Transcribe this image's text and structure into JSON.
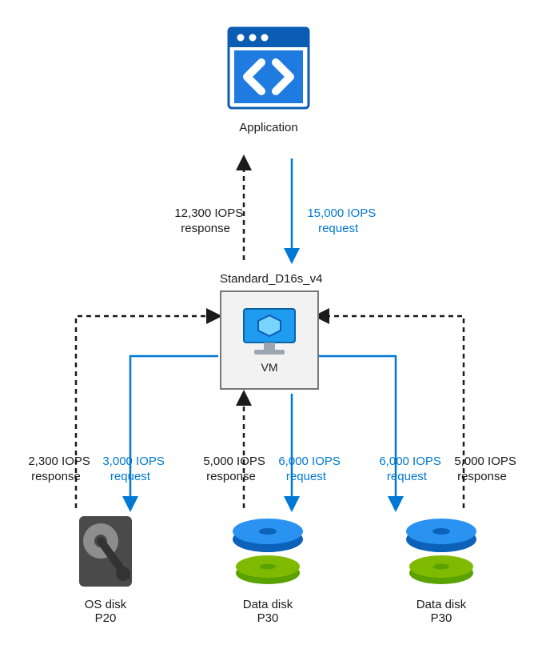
{
  "nodes": {
    "application": {
      "label": "Application"
    },
    "vm": {
      "title": "Standard_D16s_v4",
      "label": "VM"
    },
    "os_disk": {
      "label1": "OS disk",
      "label2": "P20"
    },
    "data_disk_1": {
      "label1": "Data disk",
      "label2": "P30"
    },
    "data_disk_2": {
      "label1": "Data disk",
      "label2": "P30"
    }
  },
  "flows": {
    "app_vm": {
      "request": {
        "line1": "15,000 IOPS",
        "line2": "request"
      },
      "response": {
        "line1": "12,300 IOPS",
        "line2": "response"
      }
    },
    "vm_os": {
      "request": {
        "line1": "3,000 IOPS",
        "line2": "request"
      },
      "response": {
        "line1": "2,300 IOPS",
        "line2": "response"
      }
    },
    "vm_d1": {
      "request": {
        "line1": "6,000 IOPS",
        "line2": "request"
      },
      "response": {
        "line1": "5,000 IOPS",
        "line2": "response"
      }
    },
    "vm_d2": {
      "request": {
        "line1": "6,000 IOPS",
        "line2": "request"
      },
      "response": {
        "line1": "5,000 IOPS",
        "line2": "response"
      }
    }
  },
  "chart_data": {
    "type": "flow-diagram",
    "nodes": [
      {
        "id": "app",
        "label": "Application"
      },
      {
        "id": "vm",
        "label": "Standard_D16s_v4 VM"
      },
      {
        "id": "os",
        "label": "OS disk P20"
      },
      {
        "id": "d1",
        "label": "Data disk P30"
      },
      {
        "id": "d2",
        "label": "Data disk P30"
      }
    ],
    "edges": [
      {
        "from": "app",
        "to": "vm",
        "request_iops": 15000,
        "response_iops": 12300
      },
      {
        "from": "vm",
        "to": "os",
        "request_iops": 3000,
        "response_iops": 2300
      },
      {
        "from": "vm",
        "to": "d1",
        "request_iops": 6000,
        "response_iops": 5000
      },
      {
        "from": "vm",
        "to": "d2",
        "request_iops": 6000,
        "response_iops": 5000
      }
    ]
  }
}
